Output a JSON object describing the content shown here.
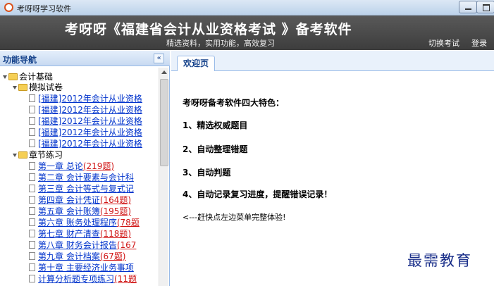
{
  "window": {
    "title": "考呀呀学习软件"
  },
  "header": {
    "title": "考呀呀《福建省会计从业资格考试 》备考软件",
    "subtitle": "精选资料，实用功能，高效复习",
    "switch_exam": "切换考试",
    "login": "登录"
  },
  "nav": {
    "title": "功能导航",
    "collapse_glyph": "«",
    "tree": {
      "root": "会计基础",
      "group_mock": "模拟试卷",
      "mock_items": [
        "[福建]2012年会计从业资格",
        "[福建]2012年会计从业资格",
        "[福建]2012年会计从业资格",
        "[福建]2012年会计从业资格",
        "[福建]2012年会计从业资格"
      ],
      "group_chapters": "章节练习",
      "chapters": [
        {
          "label": "第一章 总论",
          "count": "(219题)"
        },
        {
          "label": "第二章 会计要素与会计科",
          "count": ""
        },
        {
          "label": "第三章 会计等式与复式记",
          "count": ""
        },
        {
          "label": "第四章 会计凭证",
          "count": "(164题)"
        },
        {
          "label": "第五章 会计账簿",
          "count": "(195题)"
        },
        {
          "label": "第六章 账务处理程序",
          "count": "(78题"
        },
        {
          "label": "第七章 财产清查",
          "count": "(118题)"
        },
        {
          "label": "第八章 财务会计报告",
          "count": "(167"
        },
        {
          "label": "第九章 会计档案",
          "count": "(67题)"
        },
        {
          "label": "第十章 主要经济业务事项",
          "count": ""
        },
        {
          "label": "计算分析题专项练习",
          "count": "(11题"
        }
      ]
    }
  },
  "tabs": [
    {
      "label": "欢迎页"
    }
  ],
  "welcome": {
    "heading": "考呀呀备考软件四大特色：",
    "features": [
      "1、精选权威题目",
      "2、自动整理错题",
      "3、自动判题",
      "4、自动记录复习进度，提醒错误记录！"
    ],
    "hint": "<---赶快点左边菜单完整体验!"
  },
  "watermark": "最需教育",
  "colors": {
    "banner": "#4a4a4a",
    "nav_header": "#c8daf1",
    "link": "#0033cc",
    "count": "#d01515",
    "watermark": "#1a2f8a"
  }
}
